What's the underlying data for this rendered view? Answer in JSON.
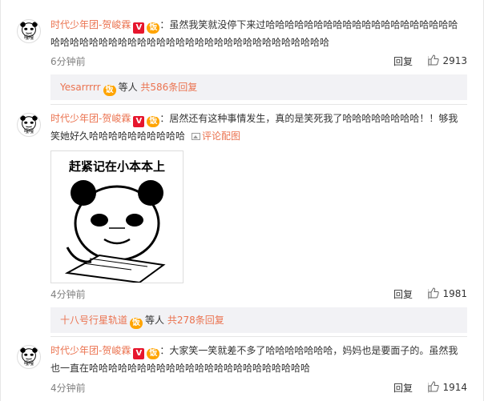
{
  "comments": [
    {
      "username": "时代少年团-贺峻霖",
      "badge_v": "V",
      "badge_fan": "饭",
      "text": "：虽然我笑就没停下来过哈哈哈哈哈哈哈哈哈哈哈哈哈哈哈哈哈哈哈哈哈哈哈哈哈哈哈哈哈哈哈哈哈哈哈哈哈哈哈哈哈哈哈哈哈哈哈哈哈",
      "time": "6分钟前",
      "reply_label": "回复",
      "likes": "2913",
      "avatar_label": "嘎嘎"
    },
    {
      "username": "时代少年团-贺峻霖",
      "badge_v": "V",
      "badge_fan": "饭",
      "text": "：居然还有这种事情发生，真的是笑死我了哈哈哈哈哈哈哈哈！！够我笑她好久哈哈哈哈哈哈哈哈哈哈",
      "pic_link": "评论配图",
      "meme_caption": "赶紧记在小本本上",
      "time": "4分钟前",
      "reply_label": "回复",
      "likes": "1981",
      "avatar_label": "嘎嘎"
    },
    {
      "username": "时代少年团-贺峻霖",
      "badge_v": "V",
      "badge_fan": "饭",
      "text": "：大家笑一笑就差不多了哈哈哈哈哈哈哈，妈妈也是要面子的。虽然我也一直在哈哈哈哈哈哈哈哈哈哈哈哈哈哈哈哈哈哈哈哈哈哈哈",
      "time": "4分钟前",
      "reply_label": "回复",
      "likes": "1914",
      "avatar_label": "嘎嘎"
    }
  ],
  "reply_summaries": [
    {
      "who": "Yesarrrrr",
      "badge": "饭",
      "middle": "等人",
      "count": "共586条回复"
    },
    {
      "who": "十八号行星轨道",
      "badge": "饭",
      "middle": "等人",
      "count": "共278条回复"
    }
  ],
  "colors": {
    "link": "#eb7350",
    "muted": "#808080",
    "reply_bg": "#f2f2f5"
  }
}
